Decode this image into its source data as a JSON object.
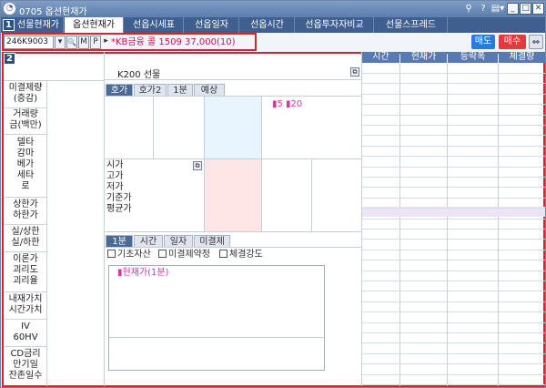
{
  "window": {
    "title": "0705 옵션현재가"
  },
  "titlebar_buttons": {
    "pin": "⚲",
    "help": "?",
    "settings": "▤▾",
    "minimize": "_",
    "maximize": "□",
    "close": "✕"
  },
  "tabs": [
    {
      "label": "선물현재가",
      "active": false
    },
    {
      "label": "옵션현재가",
      "active": true
    },
    {
      "label": "선옵시세표",
      "active": false
    },
    {
      "label": "선옵일자",
      "active": false
    },
    {
      "label": "선옵시간",
      "active": false
    },
    {
      "label": "선옵투자자비교",
      "active": false
    },
    {
      "label": "선물스프레드",
      "active": false
    }
  ],
  "badges": {
    "first": "1",
    "second": "2"
  },
  "toolbar": {
    "code_value": "246K9003",
    "dropdown": "▾",
    "search_icon": "🔍",
    "m_button": "M",
    "p_button": "P",
    "arrow_button": "▸",
    "issue_name": "*KB금융 콜 1509 37,000(10)",
    "sell_label": "매도",
    "buy_label": "매수",
    "link_icon": "⇔"
  },
  "colors": {
    "sell": "#2e78e6",
    "buy": "#e23b3b",
    "header": "#587ab0",
    "accent": "#d13aa5"
  },
  "left_labels": [
    "미결제량\n(증감)",
    "거래량\n금(백만)",
    "델타\n감마\n베가\n세타\n로",
    "상한가\n하한가",
    "실/상한\n실/하한",
    "이론가\n괴리도\n괴리율",
    "내재가치\n시간가치",
    "IV\n60HV",
    "CD금리\n만기일\n잔존일수"
  ],
  "summary": {
    "title": "K200 선물"
  },
  "quote_tabs": [
    "호가",
    "호가2",
    "1분",
    "예상"
  ],
  "quote_marks": "▮5 ▮20",
  "price_labels": [
    "시가",
    "고가",
    "저가",
    "기준가",
    "평균가"
  ],
  "chart_tabs": [
    "1분",
    "시간",
    "일자",
    "미결제"
  ],
  "checkboxes": [
    "기초자산",
    "미결제약정",
    "체결강도"
  ],
  "chart_legend": "▮현재가(1분)",
  "trade_grid": {
    "columns": [
      "시간",
      "현재가",
      "등락폭",
      "체결량"
    ]
  }
}
